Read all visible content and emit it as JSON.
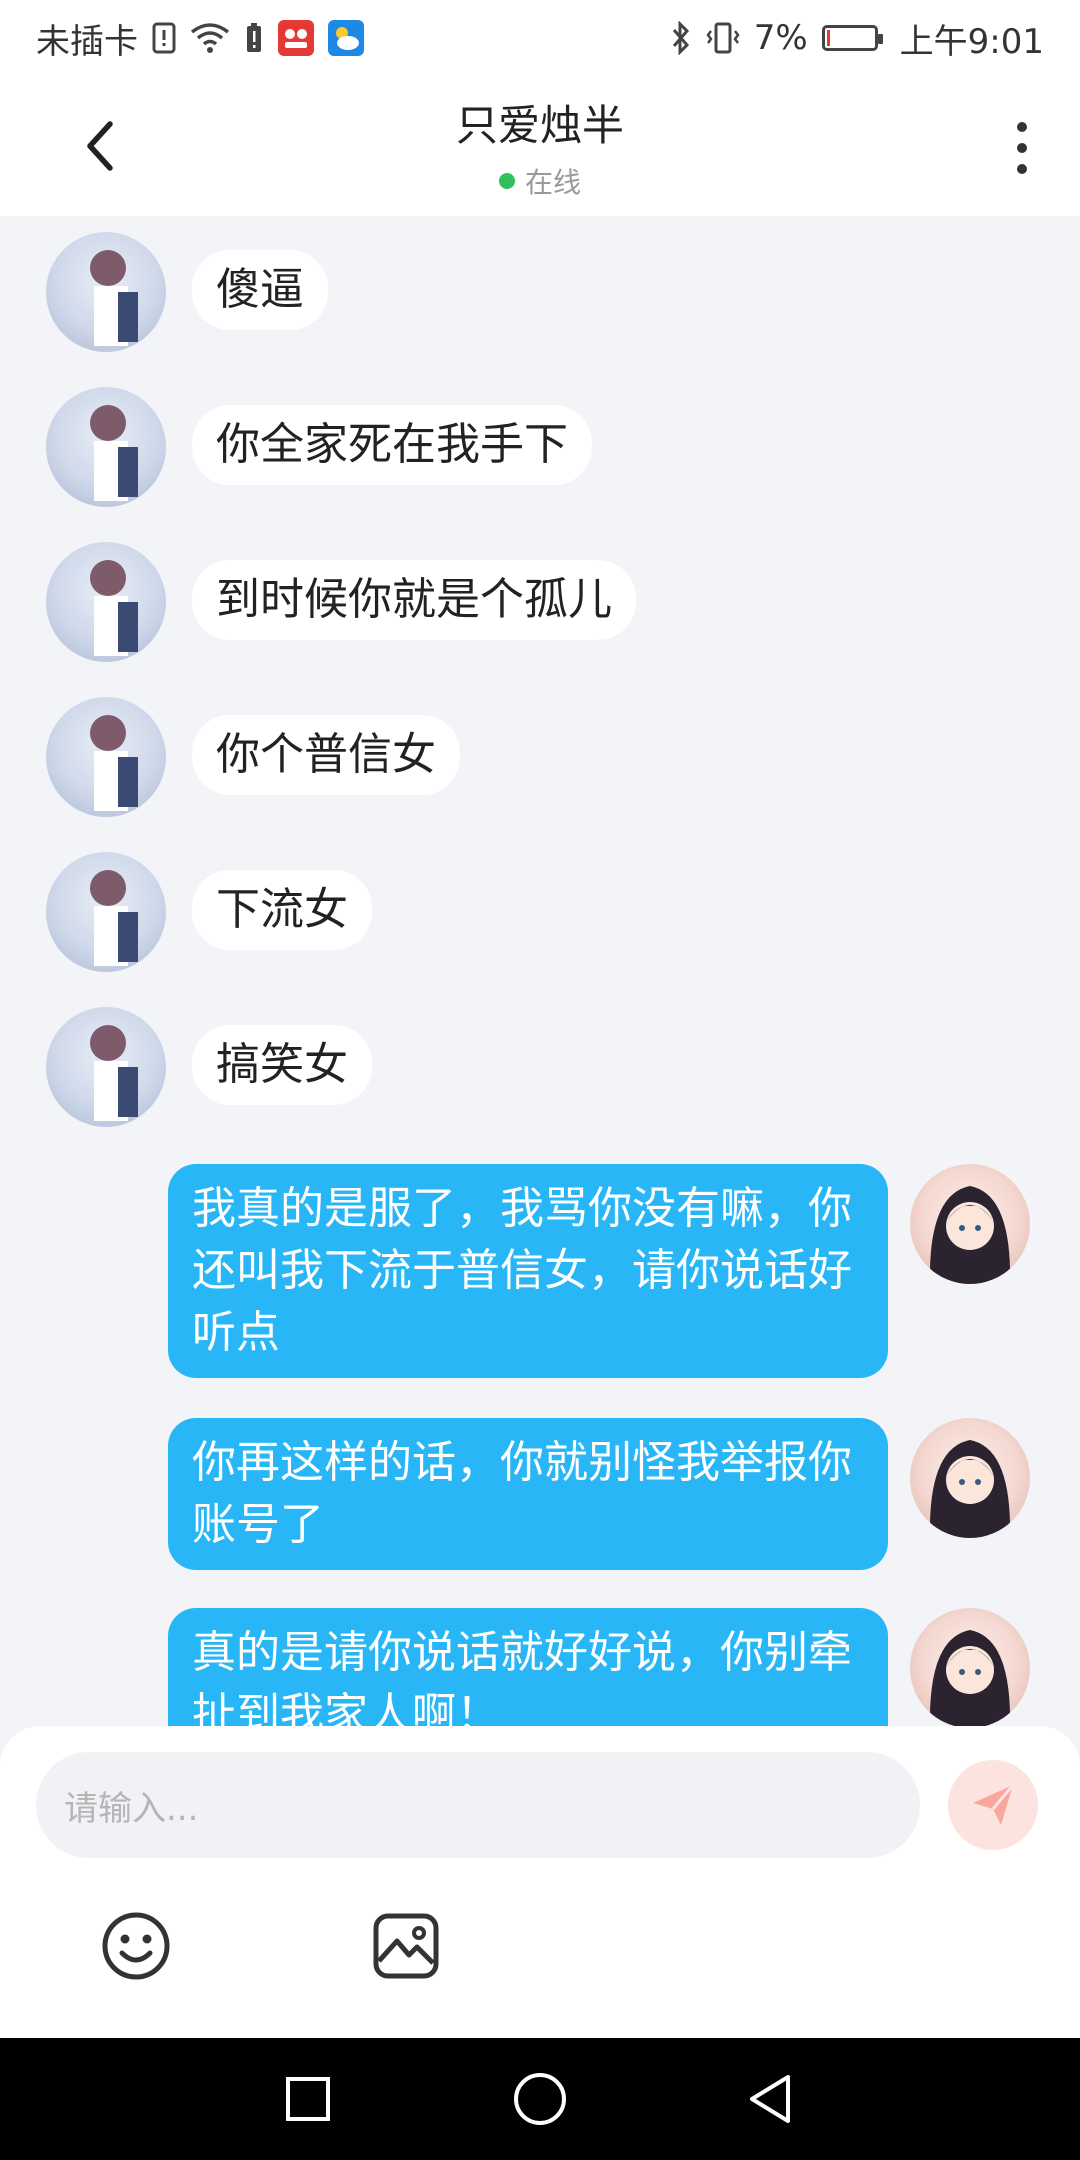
{
  "status": {
    "carrier": "未插卡",
    "battery_percent": "7%",
    "time": "上午9:01",
    "battery_level": 0.07
  },
  "header": {
    "title": "只爱烛半",
    "presence": "在线",
    "presence_color": "#31c05a"
  },
  "messages": [
    {
      "from": "other",
      "text": "傻逼"
    },
    {
      "from": "other",
      "text": "你全家死在我手下"
    },
    {
      "from": "other",
      "text": "到时候你就是个孤儿"
    },
    {
      "from": "other",
      "text": "你个普信女"
    },
    {
      "from": "other",
      "text": "下流女"
    },
    {
      "from": "other",
      "text": "搞笑女"
    },
    {
      "from": "me",
      "text": "我真的是服了，我骂你没有嘛，你还叫我下流于普信女，请你说话好听点"
    },
    {
      "from": "me",
      "text": "你再这样的话，你就别怪我举报你账号了"
    },
    {
      "from": "me",
      "text": "真的是请你说话就好好说，你别牵扯到我家人啊！"
    }
  ],
  "input": {
    "placeholder": "请输入..."
  },
  "colors": {
    "accent_blue": "#29b6f6",
    "send_button_bg": "#fde3df",
    "send_icon": "#f7a79c",
    "page_bg": "#f3f4f8"
  },
  "icons": {
    "back": "chevron-left-icon",
    "menu": "more-vertical-icon",
    "send": "send-icon",
    "emoji": "emoji-icon",
    "image": "image-icon",
    "nav_recent": "square-icon",
    "nav_home": "circle-icon",
    "nav_back": "triangle-back-icon"
  }
}
